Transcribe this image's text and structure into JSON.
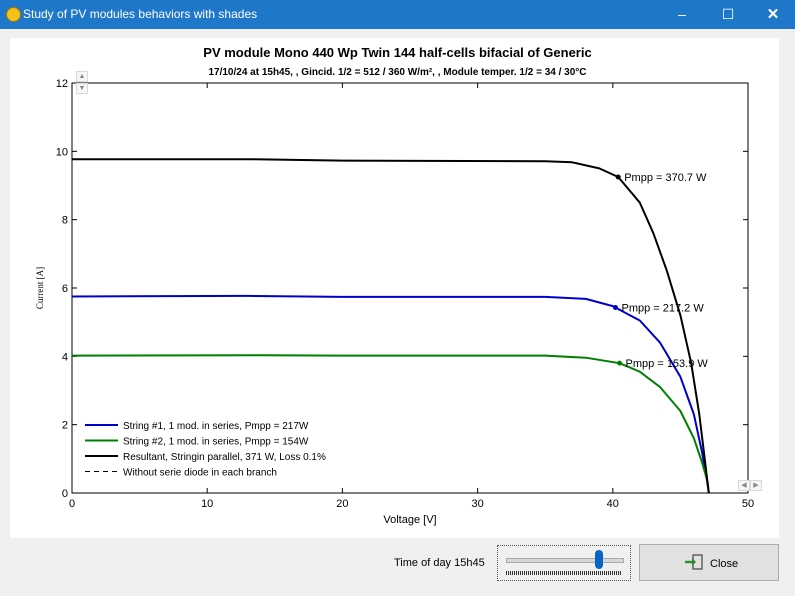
{
  "window": {
    "title": "Study of PV modules behaviors with shades",
    "minimize_glyph": "–",
    "maximize_glyph": "☐",
    "close_glyph": "✕"
  },
  "chart_data": {
    "type": "line",
    "title": "PV module Mono 440 Wp Twin 144 half-cells bifacial of Generic",
    "subtitle": "17/10/24 at 15h45, , Gincid. 1/2 = 512 / 360 W/m², , Module temper. 1/2 = 34 / 30°C",
    "xlabel": "Voltage [V]",
    "ylabel": "Current [A]",
    "xlim": [
      0,
      50
    ],
    "ylim": [
      0,
      12
    ],
    "xticks": [
      0,
      10,
      20,
      30,
      40,
      50
    ],
    "yticks": [
      0,
      2,
      4,
      6,
      8,
      10,
      12
    ],
    "grid": false,
    "legend_position": "bottom-left",
    "series": [
      {
        "name": "String #1, 1 mod. in series, Pmpp = 217W",
        "color": "#0000cc",
        "dash": "",
        "points": [
          [
            0,
            5.75
          ],
          [
            13,
            5.77
          ],
          [
            20,
            5.74
          ],
          [
            35,
            5.74
          ],
          [
            38,
            5.68
          ],
          [
            40,
            5.47
          ],
          [
            42,
            5.05
          ],
          [
            43.5,
            4.4
          ],
          [
            45,
            3.4
          ],
          [
            46,
            2.3
          ],
          [
            46.6,
            1.2
          ],
          [
            47,
            0.3
          ],
          [
            47.1,
            0
          ]
        ],
        "mpp": {
          "x": 40.2,
          "y": 5.43,
          "label": "Pmpp = 217.2 W"
        }
      },
      {
        "name": "String #2, 1 mod. in series, Pmpp = 154W",
        "color": "#008000",
        "dash": "",
        "points": [
          [
            0,
            4.02
          ],
          [
            14,
            4.03
          ],
          [
            20,
            4.02
          ],
          [
            35,
            4.02
          ],
          [
            38,
            3.96
          ],
          [
            40.5,
            3.8
          ],
          [
            42,
            3.55
          ],
          [
            43.5,
            3.1
          ],
          [
            45,
            2.4
          ],
          [
            46,
            1.6
          ],
          [
            46.6,
            0.9
          ],
          [
            47,
            0.35
          ],
          [
            47.1,
            0
          ]
        ],
        "mpp": {
          "x": 40.5,
          "y": 3.8,
          "label": "Pmpp = 153.9 W"
        }
      },
      {
        "name": "Resultant, Stringin parallel, 371 W, Loss 0.1%",
        "color": "#000000",
        "dash": "",
        "points": [
          [
            0,
            9.77
          ],
          [
            13,
            9.77
          ],
          [
            20,
            9.73
          ],
          [
            35,
            9.71
          ],
          [
            37,
            9.68
          ],
          [
            39,
            9.5
          ],
          [
            40.4,
            9.25
          ],
          [
            42,
            8.5
          ],
          [
            43,
            7.6
          ],
          [
            44,
            6.5
          ],
          [
            45,
            5.2
          ],
          [
            45.8,
            3.8
          ],
          [
            46.4,
            2.3
          ],
          [
            46.8,
            1.0
          ],
          [
            47.1,
            0
          ]
        ],
        "mpp": {
          "x": 40.4,
          "y": 9.25,
          "label": "Pmpp = 370.7 W"
        }
      },
      {
        "name": "Without serie diode in each branch",
        "color": "#000000",
        "dash": "5,4",
        "points": []
      }
    ]
  },
  "footer": {
    "time_label": "Time of day 15h45",
    "slider_position": 0.8,
    "close_label": "Close"
  }
}
